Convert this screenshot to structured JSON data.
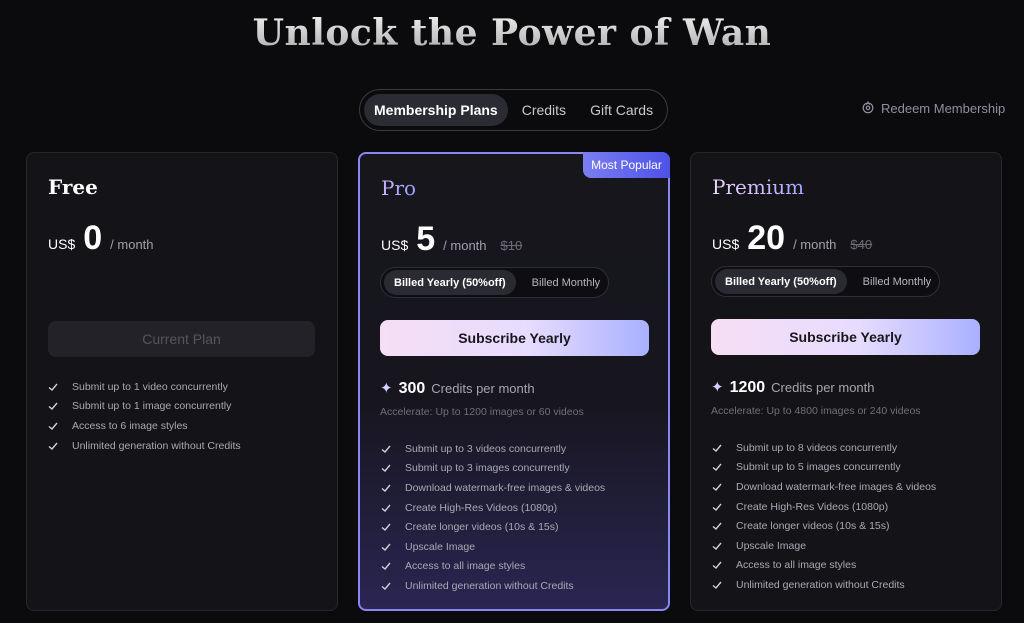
{
  "header": {
    "title": "Unlock the Power of Wan"
  },
  "tabs": [
    {
      "label": "Membership Plans",
      "active": true
    },
    {
      "label": "Credits",
      "active": false
    },
    {
      "label": "Gift Cards",
      "active": false
    }
  ],
  "redeem": {
    "label": "Redeem Membership",
    "icon": "gift-icon"
  },
  "plans": {
    "free": {
      "name": "Free",
      "currency": "US$",
      "price": "0",
      "period": "/ month",
      "button": "Current Plan",
      "features": [
        "Submit up to 1 video concurrently",
        "Submit up to 1 image concurrently",
        "Access to 6 image styles",
        "Unlimited generation without Credits"
      ]
    },
    "pro": {
      "badge": "Most Popular",
      "name": "Pro",
      "currency": "US$",
      "price": "5",
      "period": "/ month",
      "original_price": "$10",
      "billing_yearly": "Billed Yearly (50%off)",
      "billing_monthly": "Billed Monthly",
      "button": "Subscribe Yearly",
      "credits": "300",
      "credits_label": "Credits per month",
      "accelerate": "Accelerate: Up to 1200 images or 60 videos",
      "features": [
        "Submit up to 3 videos concurrently",
        "Submit up to 3 images concurrently",
        "Download watermark-free images & videos",
        "Create High-Res Videos (1080p)",
        "Create longer videos (10s & 15s)",
        "Upscale Image",
        "Access to all image styles",
        "Unlimited generation without Credits"
      ]
    },
    "premium": {
      "name": "Premium",
      "currency": "US$",
      "price": "20",
      "period": "/ month",
      "original_price": "$40",
      "billing_yearly": "Billed Yearly (50%off)",
      "billing_monthly": "Billed Monthly",
      "button": "Subscribe Yearly",
      "credits": "1200",
      "credits_label": "Credits per month",
      "accelerate": "Accelerate: Up to 4800 images or 240 videos",
      "features": [
        "Submit up to 8 videos concurrently",
        "Submit up to 5 images concurrently",
        "Download watermark-free images & videos",
        "Create High-Res Videos (1080p)",
        "Create longer videos (10s & 15s)",
        "Upscale Image",
        "Access to all image styles",
        "Unlimited generation without Credits"
      ]
    }
  },
  "colors": {
    "background": "#0b0b0d",
    "card": "#141418",
    "pro_border": "#8a86f2",
    "badge": "#5b60ea"
  }
}
